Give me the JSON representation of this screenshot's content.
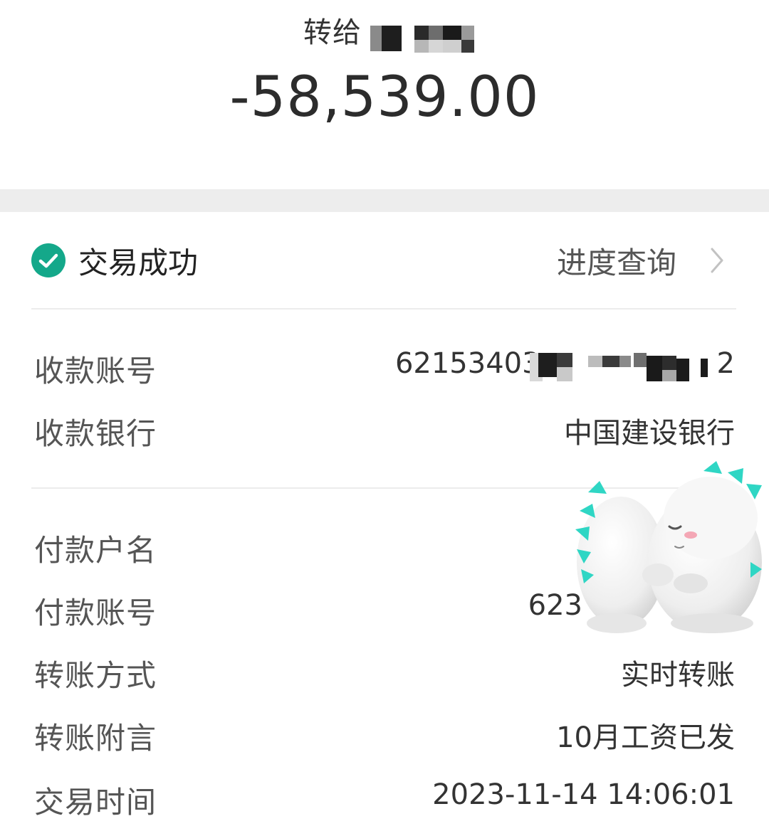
{
  "header": {
    "recipient_prefix": "转给",
    "amount": "-58,539.00"
  },
  "status": {
    "label": "交易成功",
    "progress_link": "进度查询",
    "icon": "check-circle-icon",
    "icon_color": "#14a88a"
  },
  "details": {
    "receiver_account": {
      "label": "收款账号",
      "value": "62153403",
      "value_tail": "2"
    },
    "receiver_bank": {
      "label": "收款银行",
      "value": "中国建设银行"
    },
    "payer_name": {
      "label": "付款户名",
      "value": ""
    },
    "payer_account": {
      "label": "付款账号",
      "value": "623"
    },
    "transfer_method": {
      "label": "转账方式",
      "value": "实时转账"
    },
    "transfer_note": {
      "label": "转账附言",
      "value": "10月工资已发"
    },
    "transaction_time": {
      "label": "交易时间",
      "value": "2023-11-14 14:06:01"
    }
  },
  "colors": {
    "accent": "#14a88a",
    "band": "#ededed",
    "sticker_spikes": "#2fd6c4"
  }
}
